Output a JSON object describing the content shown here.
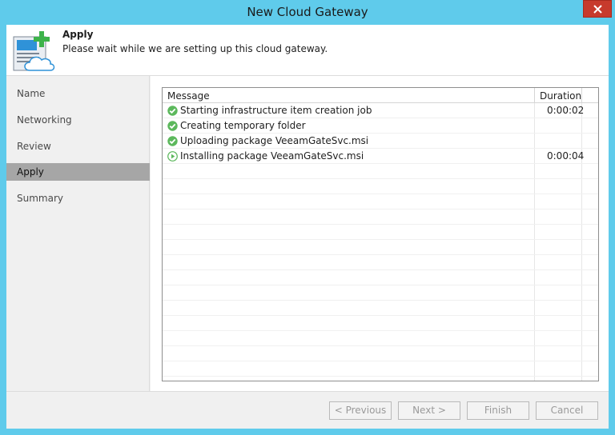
{
  "window": {
    "title": "New Cloud Gateway"
  },
  "header": {
    "title": "Apply",
    "subtitle": "Please wait while we are setting up this cloud gateway.",
    "icon": "server-cloud-add-icon"
  },
  "sidebar": {
    "steps": [
      {
        "label": "Name"
      },
      {
        "label": "Networking"
      },
      {
        "label": "Review"
      },
      {
        "label": "Apply",
        "active": true
      },
      {
        "label": "Summary"
      }
    ]
  },
  "log": {
    "columns": {
      "message": "Message",
      "duration": "Duration"
    },
    "rows": [
      {
        "status": "success",
        "message": "Starting infrastructure item creation job",
        "duration": "0:00:02"
      },
      {
        "status": "success",
        "message": "Creating temporary folder",
        "duration": ""
      },
      {
        "status": "success",
        "message": "Uploading package VeeamGateSvc.msi",
        "duration": ""
      },
      {
        "status": "running",
        "message": "Installing package VeeamGateSvc.msi",
        "duration": "0:00:04"
      }
    ]
  },
  "footer": {
    "previous": "< Previous",
    "next": "Next >",
    "finish": "Finish",
    "cancel": "Cancel"
  },
  "colors": {
    "titlebar": "#5fcbeb",
    "close": "#c73a2c",
    "success": "#5cb85c",
    "active_step": "#a6a6a6"
  }
}
